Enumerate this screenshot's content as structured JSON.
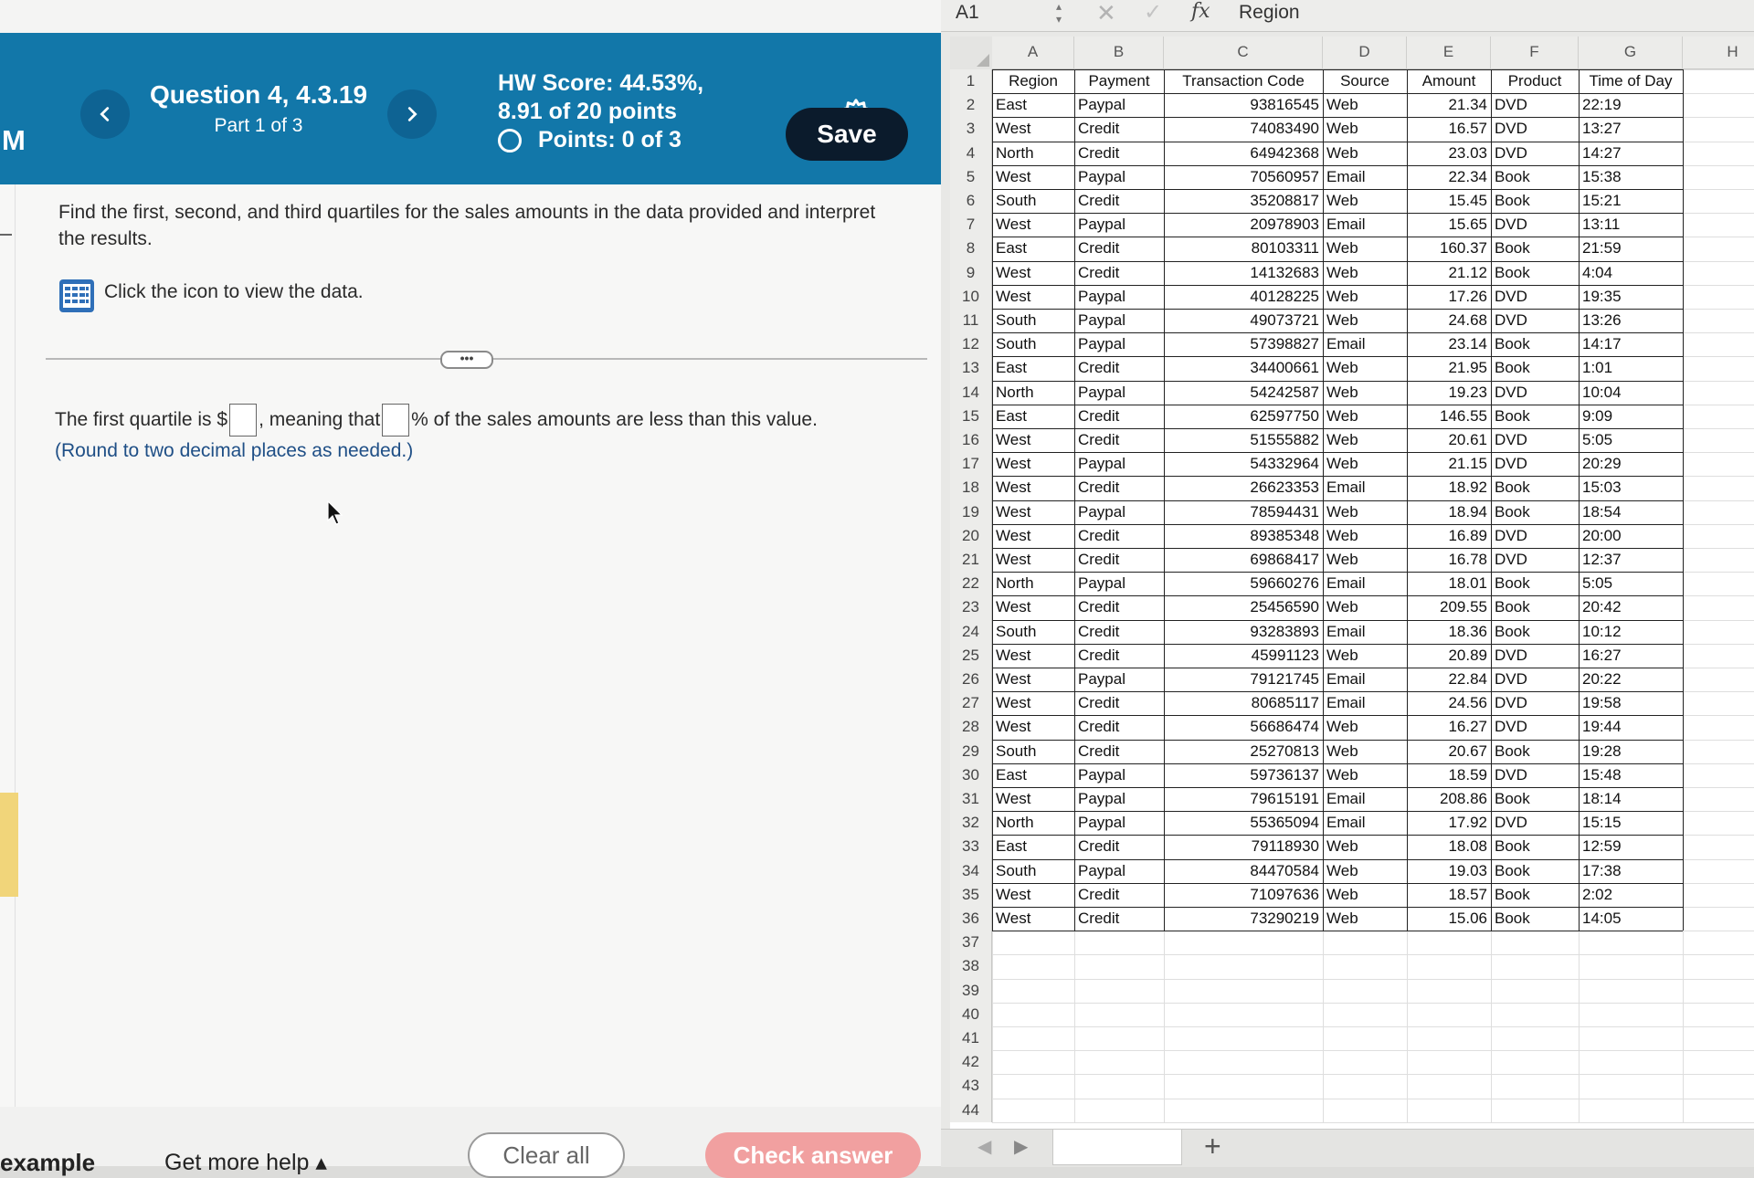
{
  "brand": "M",
  "question": {
    "title": "Question 4, 4.3.19",
    "part": "Part 1 of 3",
    "hw_score_line1": "HW Score: 44.53%,",
    "hw_score_line2": "8.91 of 20 points",
    "points": "Points: 0 of 3",
    "save_label": "Save",
    "prompt": "Find the first, second, and third quartiles for the sales amounts in the data provided and interpret the results.",
    "data_link": "Click the icon to view the data.",
    "expander": "•••",
    "answer_part1": "The first quartile is $",
    "answer_part2": ", meaning that ",
    "answer_part3": "% of the sales amounts are less than this value.",
    "round_note": "(Round to two decimal places as needed.)"
  },
  "footer": {
    "example": "example",
    "more_help": "Get more help ▴",
    "clear_all": "Clear all",
    "check_answer": "Check answer"
  },
  "formula_bar": {
    "cell_ref": "A1",
    "content": "Region",
    "fx": "fx"
  },
  "sheet": {
    "columns": [
      "A",
      "B",
      "C",
      "D",
      "E",
      "F",
      "G",
      "H"
    ],
    "headers": [
      "Region",
      "Payment",
      "Transaction Code",
      "Source",
      "Amount",
      "Product",
      "Time of Day"
    ],
    "rows": [
      [
        "East",
        "Paypal",
        "93816545",
        "Web",
        "21.34",
        "DVD",
        "22:19"
      ],
      [
        "West",
        "Credit",
        "74083490",
        "Web",
        "16.57",
        "DVD",
        "13:27"
      ],
      [
        "North",
        "Credit",
        "64942368",
        "Web",
        "23.03",
        "DVD",
        "14:27"
      ],
      [
        "West",
        "Paypal",
        "70560957",
        "Email",
        "22.34",
        "Book",
        "15:38"
      ],
      [
        "South",
        "Credit",
        "35208817",
        "Web",
        "15.45",
        "Book",
        "15:21"
      ],
      [
        "West",
        "Paypal",
        "20978903",
        "Email",
        "15.65",
        "DVD",
        "13:11"
      ],
      [
        "East",
        "Credit",
        "80103311",
        "Web",
        "160.37",
        "Book",
        "21:59"
      ],
      [
        "West",
        "Credit",
        "14132683",
        "Web",
        "21.12",
        "Book",
        "4:04"
      ],
      [
        "West",
        "Paypal",
        "40128225",
        "Web",
        "17.26",
        "DVD",
        "19:35"
      ],
      [
        "South",
        "Paypal",
        "49073721",
        "Web",
        "24.68",
        "DVD",
        "13:26"
      ],
      [
        "South",
        "Paypal",
        "57398827",
        "Email",
        "23.14",
        "Book",
        "14:17"
      ],
      [
        "East",
        "Credit",
        "34400661",
        "Web",
        "21.95",
        "Book",
        "1:01"
      ],
      [
        "North",
        "Paypal",
        "54242587",
        "Web",
        "19.23",
        "DVD",
        "10:04"
      ],
      [
        "East",
        "Credit",
        "62597750",
        "Web",
        "146.55",
        "Book",
        "9:09"
      ],
      [
        "West",
        "Credit",
        "51555882",
        "Web",
        "20.61",
        "DVD",
        "5:05"
      ],
      [
        "West",
        "Paypal",
        "54332964",
        "Web",
        "21.15",
        "DVD",
        "20:29"
      ],
      [
        "West",
        "Credit",
        "26623353",
        "Email",
        "18.92",
        "Book",
        "15:03"
      ],
      [
        "West",
        "Paypal",
        "78594431",
        "Web",
        "18.94",
        "Book",
        "18:54"
      ],
      [
        "West",
        "Credit",
        "89385348",
        "Web",
        "16.89",
        "DVD",
        "20:00"
      ],
      [
        "West",
        "Credit",
        "69868417",
        "Web",
        "16.78",
        "DVD",
        "12:37"
      ],
      [
        "North",
        "Paypal",
        "59660276",
        "Email",
        "18.01",
        "Book",
        "5:05"
      ],
      [
        "West",
        "Credit",
        "25456590",
        "Web",
        "209.55",
        "Book",
        "20:42"
      ],
      [
        "South",
        "Credit",
        "93283893",
        "Email",
        "18.36",
        "Book",
        "10:12"
      ],
      [
        "West",
        "Credit",
        "45991123",
        "Web",
        "20.89",
        "DVD",
        "16:27"
      ],
      [
        "West",
        "Paypal",
        "79121745",
        "Email",
        "22.84",
        "DVD",
        "20:22"
      ],
      [
        "West",
        "Credit",
        "80685117",
        "Email",
        "24.56",
        "DVD",
        "19:58"
      ],
      [
        "West",
        "Credit",
        "56686474",
        "Web",
        "16.27",
        "DVD",
        "19:44"
      ],
      [
        "South",
        "Credit",
        "25270813",
        "Web",
        "20.67",
        "Book",
        "19:28"
      ],
      [
        "East",
        "Paypal",
        "59736137",
        "Web",
        "18.59",
        "DVD",
        "15:48"
      ],
      [
        "West",
        "Paypal",
        "79615191",
        "Email",
        "208.86",
        "Book",
        "18:14"
      ],
      [
        "North",
        "Paypal",
        "55365094",
        "Email",
        "17.92",
        "DVD",
        "15:15"
      ],
      [
        "East",
        "Credit",
        "79118930",
        "Web",
        "18.08",
        "Book",
        "12:59"
      ],
      [
        "South",
        "Paypal",
        "84470584",
        "Web",
        "19.03",
        "Book",
        "17:38"
      ],
      [
        "West",
        "Credit",
        "71097636",
        "Web",
        "18.57",
        "Book",
        "2:02"
      ],
      [
        "West",
        "Credit",
        "73290219",
        "Web",
        "15.06",
        "Book",
        "14:05"
      ]
    ],
    "row_numbers": [
      "1",
      "2",
      "3",
      "4",
      "5",
      "6",
      "7",
      "8",
      "9",
      "10",
      "11",
      "12",
      "13",
      "14",
      "15",
      "16",
      "17",
      "18",
      "19",
      "20",
      "21",
      "22",
      "23",
      "24",
      "25",
      "26",
      "27",
      "28",
      "29",
      "30",
      "31",
      "32",
      "33",
      "34",
      "35",
      "36",
      "37",
      "38",
      "39",
      "40",
      "41",
      "42",
      "43",
      "44"
    ],
    "add_sheet": "+"
  },
  "colors": {
    "header_blue": "#1277a9",
    "save_dark": "#0b1b2c",
    "check_pink": "#f1a0a0",
    "note_blue": "#1f4f86"
  },
  "icons": [
    "chevron-left-icon",
    "chevron-right-icon",
    "gear-icon",
    "points-circle-icon",
    "data-table-icon",
    "mouse-cursor-icon",
    "cancel-x-icon",
    "enter-check-icon",
    "fx-icon"
  ]
}
